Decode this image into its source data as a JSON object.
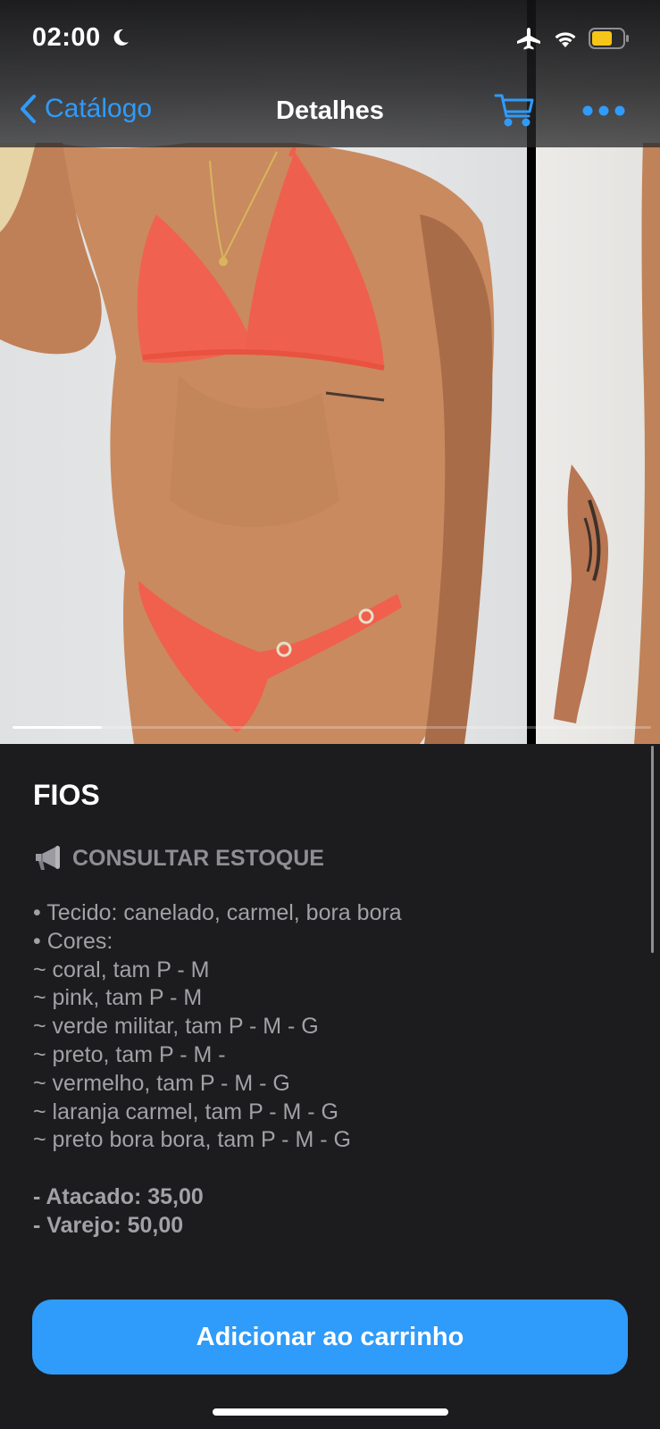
{
  "status_bar": {
    "time": "02:00",
    "icons": [
      "moon-icon",
      "airplane-icon",
      "wifi-icon",
      "battery-icon"
    ],
    "battery_color": "#f5c518"
  },
  "nav": {
    "back_label": "Catálogo",
    "title": "Detalhes",
    "accent": "#2f9bfa"
  },
  "gallery": {
    "photos": [
      "bikini-model-front",
      "bikini-model-side"
    ],
    "progress": 0.14
  },
  "product": {
    "title": "FIOS",
    "stock_icon": "megaphone-icon",
    "stock_label": "CONSULTAR ESTOQUE",
    "description": [
      "• Tecido: canelado, carmel, bora bora",
      "• Cores:",
      "~ coral, tam P - M",
      "~ pink, tam P - M",
      "~ verde militar, tam P - M - G",
      "~ preto, tam P - M -",
      "~ vermelho, tam P - M - G",
      "~ laranja carmel, tam P - M - G",
      "~ preto bora bora, tam P - M - G"
    ],
    "prices": [
      "- Atacado: 35,00",
      "- Varejo: 50,00"
    ]
  },
  "actions": {
    "add_to_cart_label": "Adicionar ao carrinho"
  }
}
